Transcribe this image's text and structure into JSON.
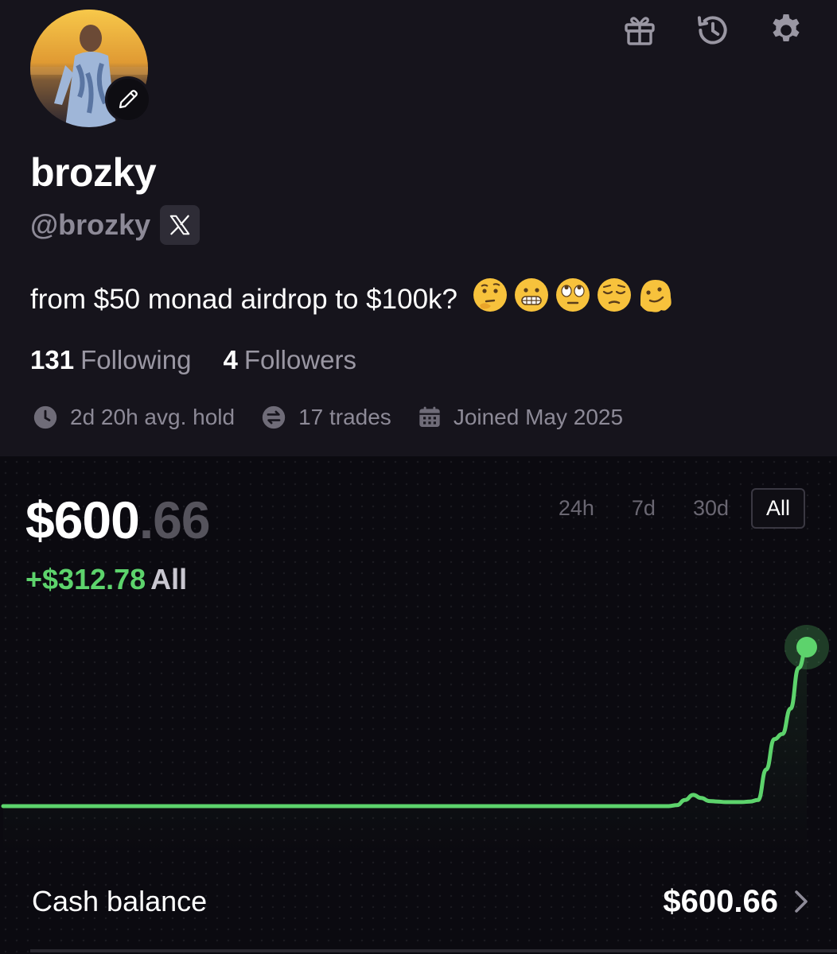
{
  "profile": {
    "display_name": "brozky",
    "handle": "@brozky",
    "bio_text": "from $50 monad airdrop to $100k?",
    "bio_emojis": [
      "thinking-face",
      "grimacing-face",
      "eye-roll-face",
      "pensive-face",
      "melting-face"
    ],
    "following_count": "131",
    "following_label": "Following",
    "followers_count": "4",
    "followers_label": "Followers",
    "avg_hold": "2d 20h avg. hold",
    "trades": "17 trades",
    "joined": "Joined May 2025"
  },
  "top_icons": [
    "gift-icon",
    "history-icon",
    "settings-gear-icon"
  ],
  "portfolio": {
    "balance_main": "$600",
    "balance_cents": ".66",
    "gain": "+$312.78",
    "gain_period": "All",
    "ranges": [
      "24h",
      "7d",
      "30d",
      "All"
    ],
    "active_range": "All",
    "cash_label": "Cash balance",
    "cash_value": "$600.66"
  },
  "colors": {
    "accent_green": "#5dd36c",
    "background": "#16141c",
    "chart_background": "#0b0a10"
  },
  "chart_data": {
    "type": "line",
    "title": "",
    "xlabel": "",
    "ylabel": "",
    "series": [
      {
        "values": [
          288,
          288,
          288,
          288,
          288,
          288,
          288,
          288,
          288,
          288,
          288,
          288,
          288,
          288,
          288,
          288,
          288,
          288,
          288,
          288,
          288,
          288,
          288,
          288,
          288,
          288,
          288,
          288,
          288,
          288,
          288,
          288,
          288,
          288,
          288,
          288,
          288,
          288,
          288,
          288,
          288,
          288,
          288,
          288,
          288,
          288,
          288,
          288,
          288,
          288,
          288,
          288,
          288,
          288,
          288,
          288,
          288,
          288,
          288,
          288,
          288,
          288,
          288,
          288,
          288,
          288,
          288,
          288,
          288,
          288,
          288,
          288,
          288,
          288,
          288,
          288,
          288,
          288,
          288,
          288,
          288,
          288,
          288,
          290,
          300,
          310,
          304,
          298,
          297,
          296,
          296,
          296,
          297,
          300,
          360,
          420,
          430,
          480,
          560,
          601
        ]
      }
    ],
    "grid": "dotted"
  }
}
